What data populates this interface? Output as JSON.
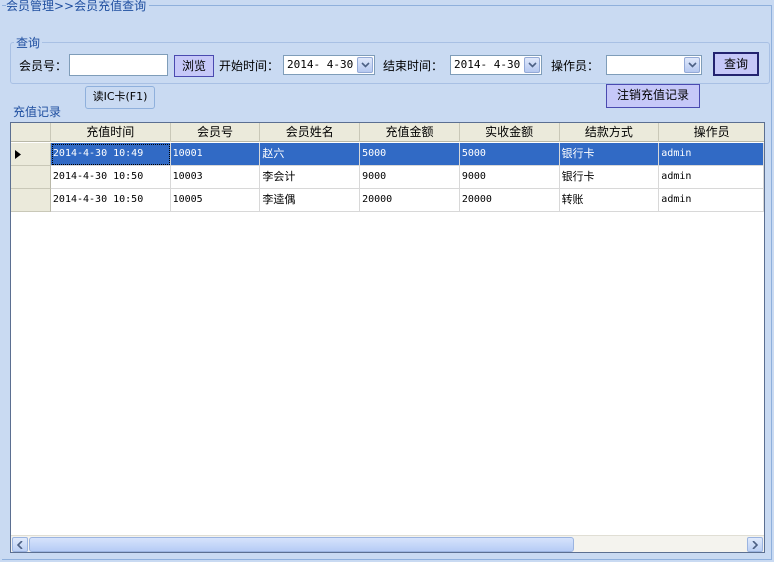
{
  "breadcrumb": "会员管理>>会员充值查询",
  "query": {
    "title": "查询",
    "member_no_label": "会员号：",
    "member_no_value": "",
    "browse_button": "浏览",
    "start_label": "开始时间：",
    "start_value": "2014- 4-30",
    "end_label": "结束时间：",
    "end_value": "2014- 4-30",
    "operator_label": "操作员：",
    "operator_value": "",
    "search_button": "查询"
  },
  "read_ic_button": "读IC卡(F1)",
  "cancel_button": "注销充值记录",
  "records_label": "充值记录",
  "table": {
    "columns": [
      "充值时间",
      "会员号",
      "会员姓名",
      "充值金额",
      "实收金额",
      "结款方式",
      "操作员"
    ],
    "rows": [
      [
        "2014-4-30 10:49",
        "10001",
        "赵六",
        "5000",
        "5000",
        "银行卡",
        "admin"
      ],
      [
        "2014-4-30 10:50",
        "10003",
        "李会计",
        "9000",
        "9000",
        "银行卡",
        "admin"
      ],
      [
        "2014-4-30 10:50",
        "10005",
        "李逵偶",
        "20000",
        "20000",
        "转账",
        "admin"
      ]
    ],
    "selected_row": 0
  },
  "colors": {
    "background": "#c9daf2",
    "selection": "#316ac5",
    "label_blue": "#1f4fa0",
    "button": "#c6c8f8"
  }
}
